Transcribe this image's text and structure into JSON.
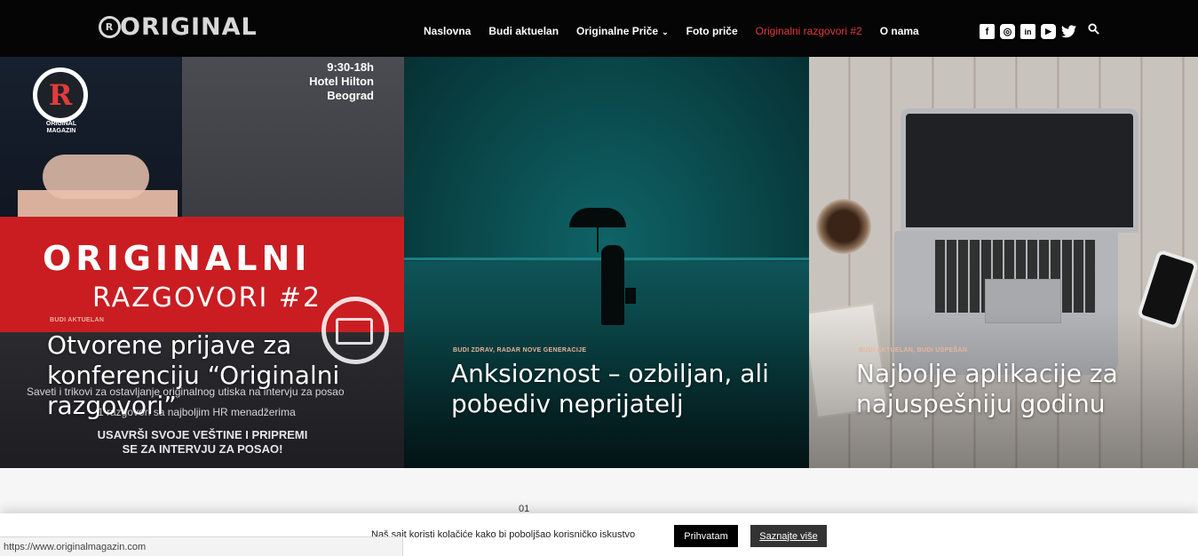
{
  "header": {
    "logo_text": "ORIGINAL",
    "logo_mark": "R",
    "nav": [
      {
        "label": "Naslovna",
        "active": false
      },
      {
        "label": "Budi aktuelan",
        "active": false
      },
      {
        "label": "Originalne Priče",
        "active": false,
        "has_dropdown": true
      },
      {
        "label": "Foto priče",
        "active": false
      },
      {
        "label": "Originalni razgovori #2",
        "active": true
      },
      {
        "label": "O nama",
        "active": false
      }
    ],
    "social": [
      {
        "icon": "facebook-icon",
        "glyph": "f"
      },
      {
        "icon": "instagram-icon",
        "glyph": "◎"
      },
      {
        "icon": "linkedin-icon",
        "glyph": "in"
      },
      {
        "icon": "youtube-icon",
        "glyph": "▶"
      },
      {
        "icon": "twitter-icon",
        "glyph": "🐦"
      }
    ],
    "search_icon": "search-icon",
    "accent_color": "#e23b3b"
  },
  "hero": {
    "cards": [
      {
        "category": "BUDI AKTUELAN",
        "title": "Otvorene prijave za konferenciju “Originalni razgovori”",
        "image": {
          "logo_letter": "R",
          "logo_caption": "ORIGINAL MAGAZIN",
          "event_lines": [
            "9:30-18h",
            "Hotel Hilton",
            "Beograd"
          ],
          "banner_big": "ORIGINALNI",
          "banner_small": "RAZGOVORI #2",
          "subtitle_1": "Saveti i trikovi za ostavljanje originalnog utiska na intervju za posao",
          "subtitle_2": "1 razgovori sa najboljim HR menadžerima",
          "subtitle_3": "USAVRŠI SVOJE VEŠTINE I PRIPREMI SE ZA INTERVJU ZA POSAO!"
        }
      },
      {
        "category": "BUDI ZDRAV, RADAR NOVE GENERACIJE",
        "title": "Anksioznost – ozbiljan, ali pobediv neprijatelj"
      },
      {
        "category": "BUDI AKTUELAN, BUDI USPEŠAN",
        "title": "Najbolje aplikacije za najuspešniju godinu"
      }
    ]
  },
  "section_counter": "01",
  "cookie_bar": {
    "text": "Naš sajt koristi kolačiće kako bi poboljšao korisničko iskustvo",
    "accept_label": "Prihvatam",
    "more_label": "Saznajte više"
  },
  "status_url": "https://www.originalmagazin.com"
}
